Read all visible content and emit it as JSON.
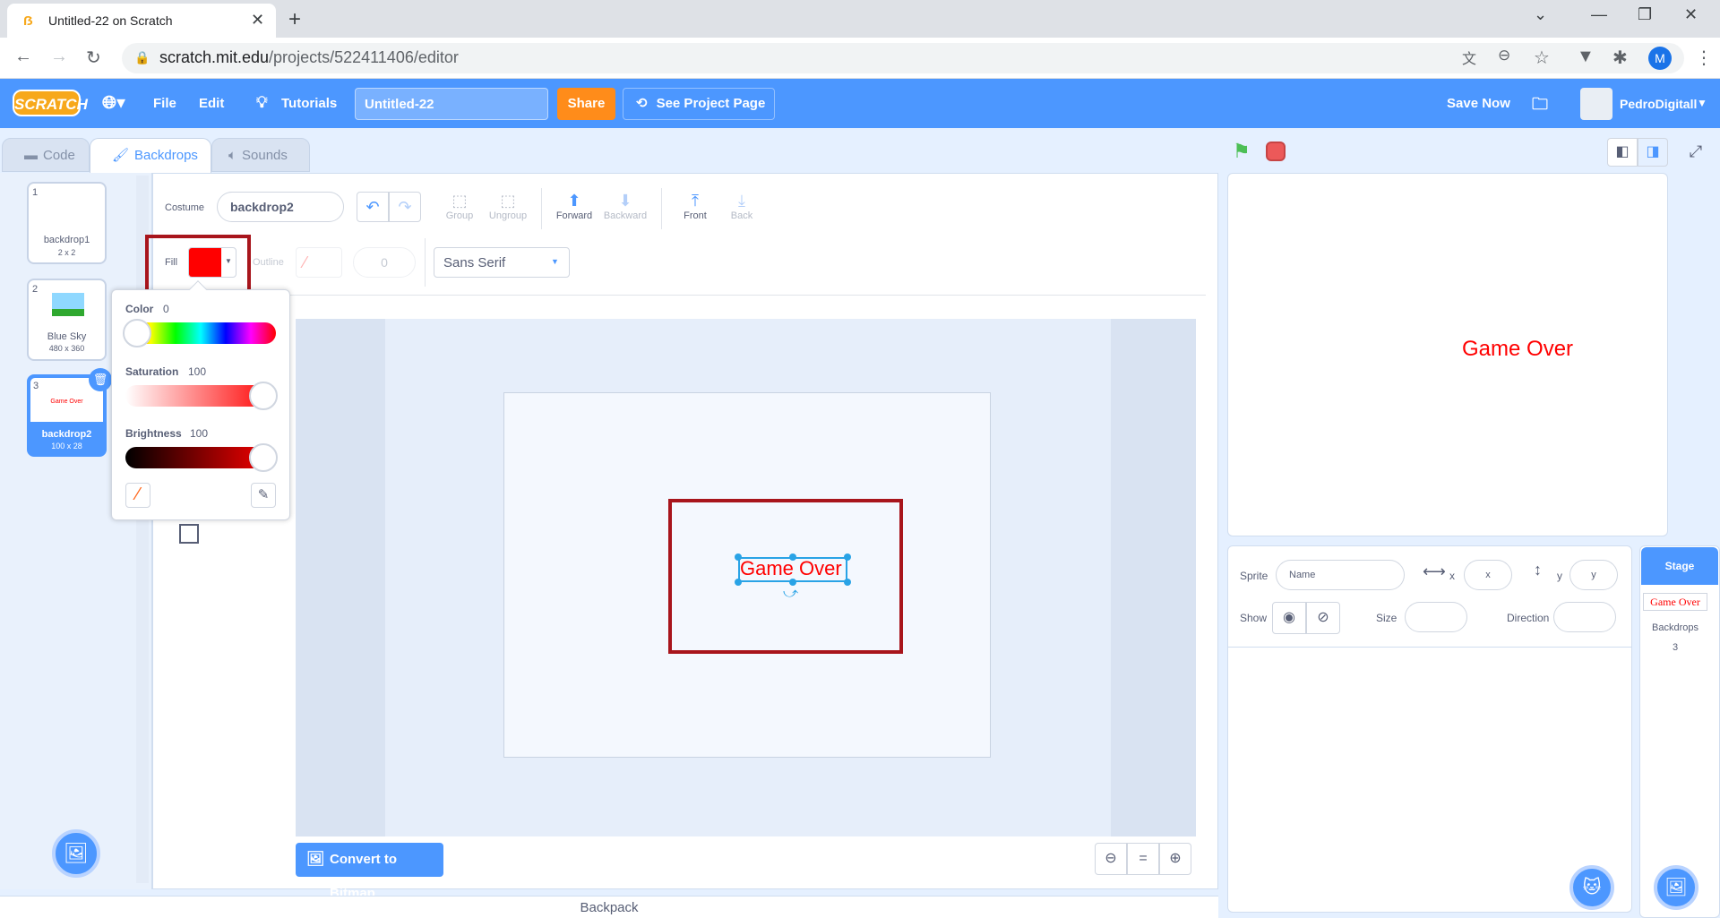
{
  "browser": {
    "tab_title": "Untitled-22 on Scratch",
    "url_host": "scratch.mit.edu",
    "url_path": "/projects/522411406/editor",
    "profile_initial": "M"
  },
  "menubar": {
    "logo": "SCRATCH",
    "file": "File",
    "edit": "Edit",
    "tutorials": "Tutorials",
    "project_title": "Untitled-22",
    "share": "Share",
    "see_project_page": "See Project Page",
    "save_now": "Save Now",
    "username": "PedroDigitall"
  },
  "tabs": {
    "code": "Code",
    "backdrops": "Backdrops",
    "sounds": "Sounds"
  },
  "backdrops": [
    {
      "num": "1",
      "name": "backdrop1",
      "size": "2 x 2"
    },
    {
      "num": "2",
      "name": "Blue Sky",
      "size": "480 x 360"
    },
    {
      "num": "3",
      "name": "backdrop2",
      "size": "100 x 28",
      "preview": "Game Over"
    }
  ],
  "editor": {
    "costume_label": "Costume",
    "costume_name": "backdrop2",
    "group": "Group",
    "ungroup": "Ungroup",
    "forward": "Forward",
    "backward": "Backward",
    "front": "Front",
    "back": "Back",
    "fill_label": "Fill",
    "fill_color": "#ff0000",
    "outline_label": "Outline",
    "outline_width": "0",
    "font": "Sans Serif",
    "canvas_text": "Game Over",
    "convert_button": "Convert to Bitmap"
  },
  "color_picker": {
    "color_label": "Color",
    "color_value": "0",
    "saturation_label": "Saturation",
    "saturation_value": "100",
    "brightness_label": "Brightness",
    "brightness_value": "100"
  },
  "backpack": "Backpack",
  "stage": {
    "text": "Game Over"
  },
  "sprite_info": {
    "sprite_label": "Sprite",
    "name_placeholder": "Name",
    "x_label": "x",
    "x_placeholder": "x",
    "y_label": "y",
    "y_placeholder": "y",
    "show_label": "Show",
    "size_label": "Size",
    "direction_label": "Direction"
  },
  "stage_panel": {
    "title": "Stage",
    "thumb_text": "Game Over",
    "backdrops_label": "Backdrops",
    "backdrops_count": "3"
  },
  "colors": {
    "scratch_blue": "#4c97ff",
    "share_orange": "#ff8c1a",
    "highlight": "#a8151c"
  }
}
